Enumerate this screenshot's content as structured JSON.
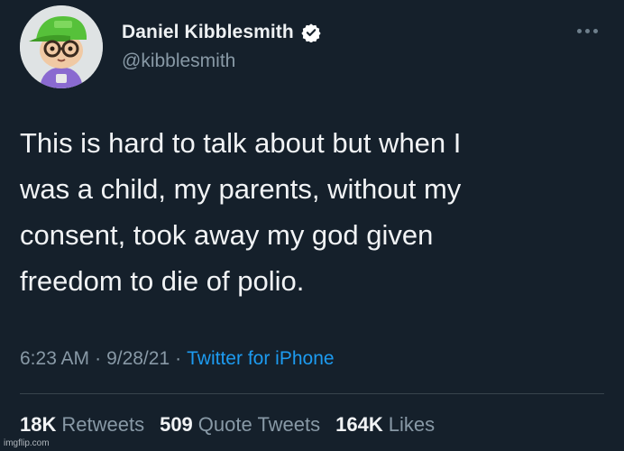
{
  "author": {
    "display_name": "Daniel Kibblesmith",
    "handle": "@kibblesmith",
    "verified": true,
    "avatar_icon": "animal-crossing-villager-avatar"
  },
  "tweet": {
    "text": "This is hard to talk about but when I\nwas a child, my parents, without my\nconsent, took away my god given\nfreedom to die of polio."
  },
  "meta": {
    "time": "6:23 AM",
    "separator": "·",
    "date": "9/28/21",
    "source": "Twitter for iPhone"
  },
  "stats": {
    "retweets_count": "18K",
    "retweets_label": "Retweets",
    "quote_tweets_count": "509",
    "quote_tweets_label": "Quote Tweets",
    "likes_count": "164K",
    "likes_label": "Likes"
  },
  "watermark": "imgflip.com",
  "colors": {
    "background": "#15202b",
    "link": "#1d9bf0",
    "secondary_text": "#8899a6"
  }
}
